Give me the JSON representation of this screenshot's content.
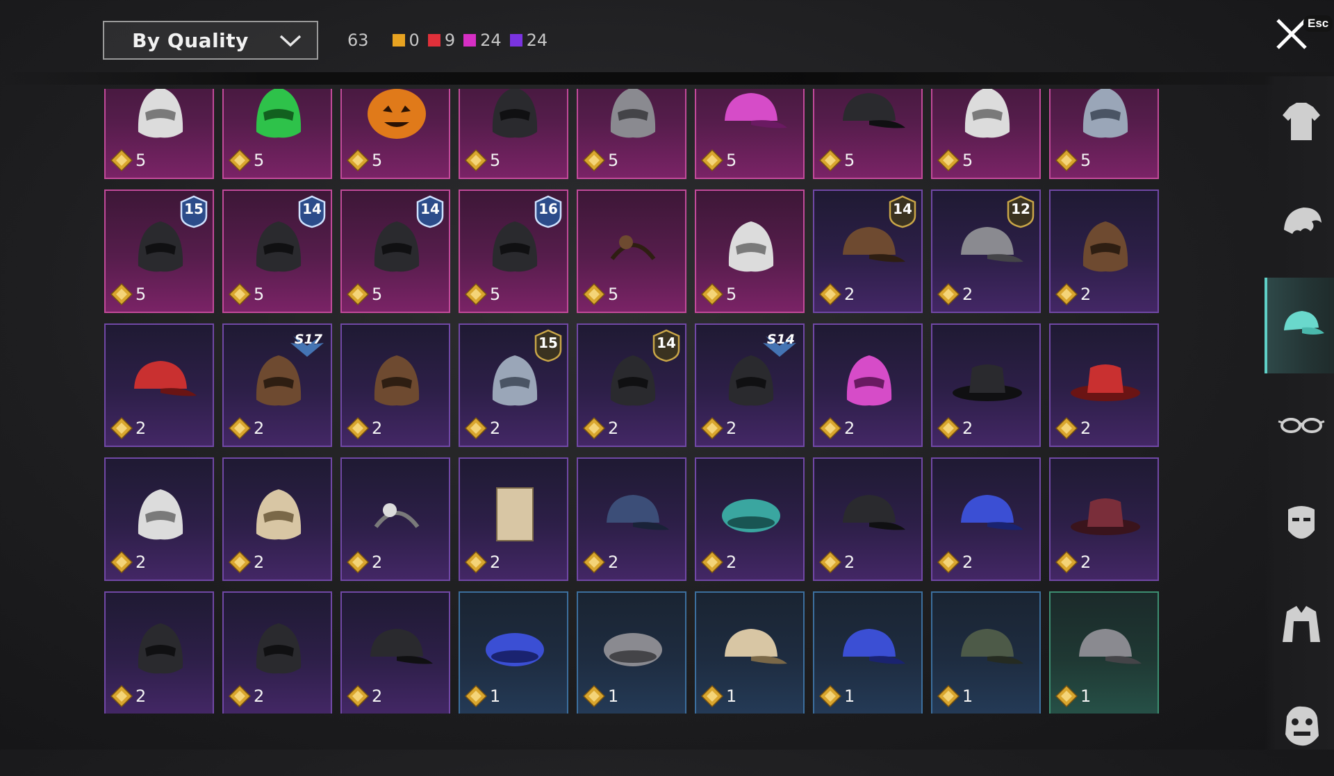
{
  "toolbar": {
    "sort_label": "By Quality",
    "total_count": "63",
    "quality_counts": [
      {
        "color": "#e8a321",
        "value": "0"
      },
      {
        "color": "#e0303a",
        "value": "9"
      },
      {
        "color": "#d62fc4",
        "value": "24"
      },
      {
        "color": "#7a33e0",
        "value": "24"
      }
    ],
    "close_hint": "Esc"
  },
  "items": [
    {
      "icon": "floral-veil-hat-icon",
      "quality": "red",
      "cost": "5"
    },
    {
      "icon": "green-leaf-hat-icon",
      "quality": "red",
      "cost": "5"
    },
    {
      "icon": "pumpkin-head-icon",
      "quality": "red",
      "cost": "5"
    },
    {
      "icon": "demon-helmet-icon",
      "quality": "red",
      "cost": "5"
    },
    {
      "icon": "skeleton-hand-hat-icon",
      "quality": "red",
      "cost": "5"
    },
    {
      "icon": "robot-cap-icon",
      "quality": "red",
      "cost": "5"
    },
    {
      "icon": "black-cap-headphones-icon",
      "quality": "red",
      "cost": "5"
    },
    {
      "icon": "white-mask-hood-icon",
      "quality": "red",
      "cost": "5"
    },
    {
      "icon": "blue-knight-helmet-icon",
      "quality": "red",
      "cost": "5"
    },
    {
      "icon": "armored-mask-helmet-icon",
      "quality": "red",
      "cost": "5",
      "badge": "15"
    },
    {
      "icon": "officer-cap-icon",
      "quality": "red",
      "cost": "5",
      "badge": "14"
    },
    {
      "icon": "spiked-officer-cap-icon",
      "quality": "red",
      "cost": "5",
      "badge": "14"
    },
    {
      "icon": "tactical-helmet-icon",
      "quality": "red",
      "cost": "5",
      "badge": "16"
    },
    {
      "icon": "horn-headband-icon",
      "quality": "red",
      "cost": "5"
    },
    {
      "icon": "chicken-head-icon",
      "quality": "red",
      "cost": "5"
    },
    {
      "icon": "cat-ear-cap-wig-icon",
      "quality": "purple",
      "cost": "2",
      "badge": "14"
    },
    {
      "icon": "bunny-ear-cap-icon",
      "quality": "purple",
      "cost": "2",
      "badge": "12"
    },
    {
      "icon": "goggles-wig-icon",
      "quality": "purple",
      "cost": "2"
    },
    {
      "icon": "red-gold-cap-icon",
      "quality": "purple",
      "cost": "2"
    },
    {
      "icon": "horned-knight-helmet-icon",
      "quality": "purple",
      "cost": "2",
      "season": "S17"
    },
    {
      "icon": "brown-wig-icon",
      "quality": "purple",
      "cost": "2"
    },
    {
      "icon": "steel-helmet-icon",
      "quality": "purple",
      "cost": "2",
      "badge": "15"
    },
    {
      "icon": "black-officer-cap-icon",
      "quality": "purple",
      "cost": "2",
      "badge": "14"
    },
    {
      "icon": "gladiator-helmet-icon",
      "quality": "purple",
      "cost": "2",
      "season": "S14"
    },
    {
      "icon": "pink-spiked-helmet-icon",
      "quality": "purple",
      "cost": "2"
    },
    {
      "icon": "black-top-hat-icon",
      "quality": "purple",
      "cost": "2"
    },
    {
      "icon": "red-fedora-icon",
      "quality": "purple",
      "cost": "2"
    },
    {
      "icon": "shark-head-icon",
      "quality": "purple",
      "cost": "2"
    },
    {
      "icon": "pudding-hat-icon",
      "quality": "purple",
      "cost": "2"
    },
    {
      "icon": "head-mirror-icon",
      "quality": "purple",
      "cost": "2"
    },
    {
      "icon": "cardboard-box-icon",
      "quality": "purple",
      "cost": "2"
    },
    {
      "icon": "navy-cap-icon",
      "quality": "purple",
      "cost": "2"
    },
    {
      "icon": "teal-beanie-icon",
      "quality": "purple",
      "cost": "2"
    },
    {
      "icon": "black-baseball-cap-icon",
      "quality": "purple",
      "cost": "2"
    },
    {
      "icon": "blue-baseball-cap-icon",
      "quality": "purple",
      "cost": "2"
    },
    {
      "icon": "maroon-fedora-icon",
      "quality": "purple",
      "cost": "2"
    },
    {
      "icon": "bandana-mask-icon",
      "quality": "purple",
      "cost": "2"
    },
    {
      "icon": "bucket-hat-icon",
      "quality": "purple",
      "cost": "2"
    },
    {
      "icon": "aviator-cap-icon",
      "quality": "purple",
      "cost": "2"
    },
    {
      "icon": "blue-beret-icon",
      "quality": "blue",
      "cost": "1"
    },
    {
      "icon": "grey-beret-icon",
      "quality": "blue",
      "cost": "1"
    },
    {
      "icon": "tan-baseball-cap-icon",
      "quality": "blue",
      "cost": "1"
    },
    {
      "icon": "blue-tan-cap-icon",
      "quality": "blue",
      "cost": "1"
    },
    {
      "icon": "camo-cap-headset-icon",
      "quality": "blue",
      "cost": "1"
    },
    {
      "icon": "dark-patrol-cap-icon",
      "quality": "green",
      "cost": "1"
    }
  ],
  "side_nav": [
    {
      "icon": "outfit-icon",
      "active": false
    },
    {
      "icon": "hair-icon",
      "active": false
    },
    {
      "icon": "hat-icon",
      "active": true
    },
    {
      "icon": "glasses-icon",
      "active": false
    },
    {
      "icon": "face-mask-icon",
      "active": false
    },
    {
      "icon": "jacket-icon",
      "active": false
    },
    {
      "icon": "creature-mask-icon",
      "active": false
    }
  ]
}
